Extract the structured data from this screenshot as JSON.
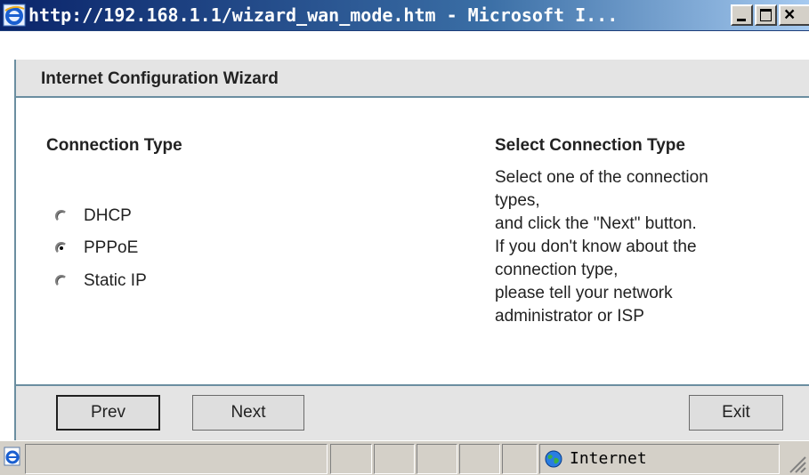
{
  "window": {
    "title": "http://192.168.1.1/wizard_wan_mode.htm - Microsoft I..."
  },
  "wizard": {
    "header_title": "Internet Configuration Wizard",
    "section_title": "Connection Type",
    "options": [
      {
        "label": "DHCP",
        "checked": false
      },
      {
        "label": "PPPoE",
        "checked": true
      },
      {
        "label": "Static IP",
        "checked": false
      }
    ],
    "help": {
      "title": "Select Connection Type",
      "lines": [
        "Select one of the connection",
        "types,",
        "and click the \"Next\" button.",
        "If you don't know about the",
        "connection type,",
        "please tell your network",
        "administrator or ISP"
      ]
    },
    "buttons": {
      "prev": "Prev",
      "next": "Next",
      "exit": "Exit"
    }
  },
  "statusbar": {
    "zone": "Internet"
  },
  "colors": {
    "titlebar_start": "#0a246a",
    "titlebar_end": "#a6caf0",
    "panel_border": "#6b8ea0",
    "bar_bg": "#e4e4e4",
    "chrome_bg": "#d4d0c8"
  }
}
